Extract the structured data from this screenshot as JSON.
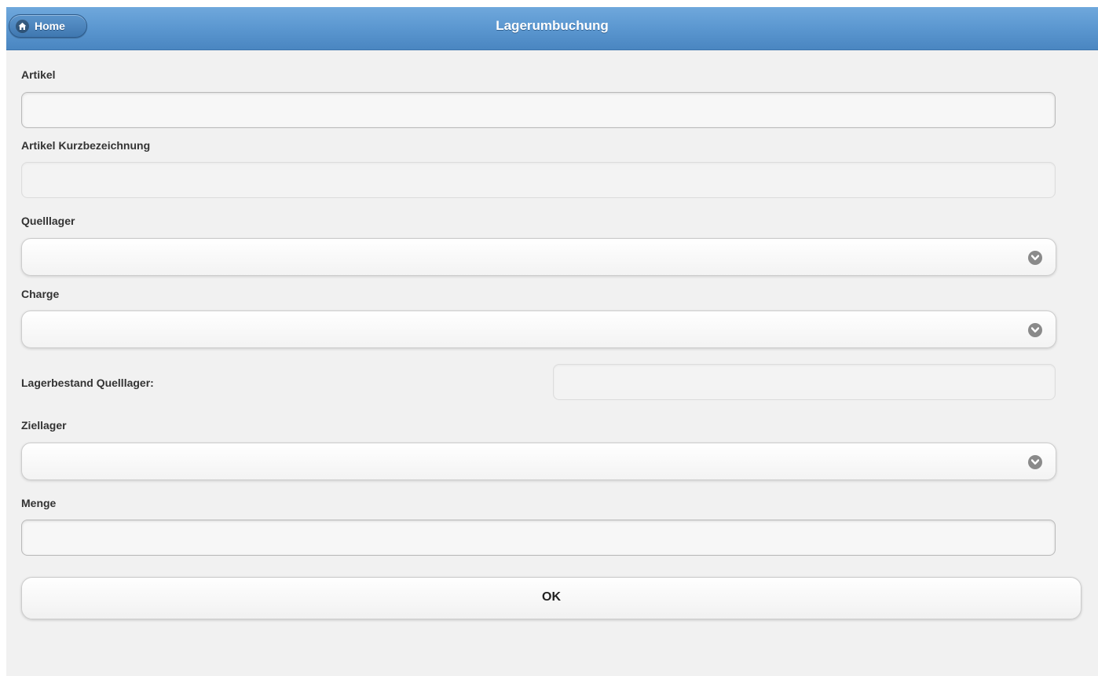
{
  "header": {
    "title": "Lagerumbuchung",
    "home_label": "Home"
  },
  "form": {
    "artikel_label": "Artikel",
    "artikel_value": "",
    "kurzbezeichnung_label": "Artikel Kurzbezeichnung",
    "kurzbezeichnung_value": "",
    "quelllager_label": "Quelllager",
    "quelllager_value": "",
    "charge_label": "Charge",
    "charge_value": "",
    "lagerbestand_label": "Lagerbestand Quelllager:",
    "lagerbestand_value": "",
    "ziellager_label": "Ziellager",
    "ziellager_value": "",
    "menge_label": "Menge",
    "menge_value": "",
    "ok_label": "OK"
  },
  "icons": {
    "home": "home-icon",
    "dropdown": "chevron-down-icon"
  },
  "colors": {
    "header": "#5b97d0",
    "background": "#f1f1f1"
  }
}
